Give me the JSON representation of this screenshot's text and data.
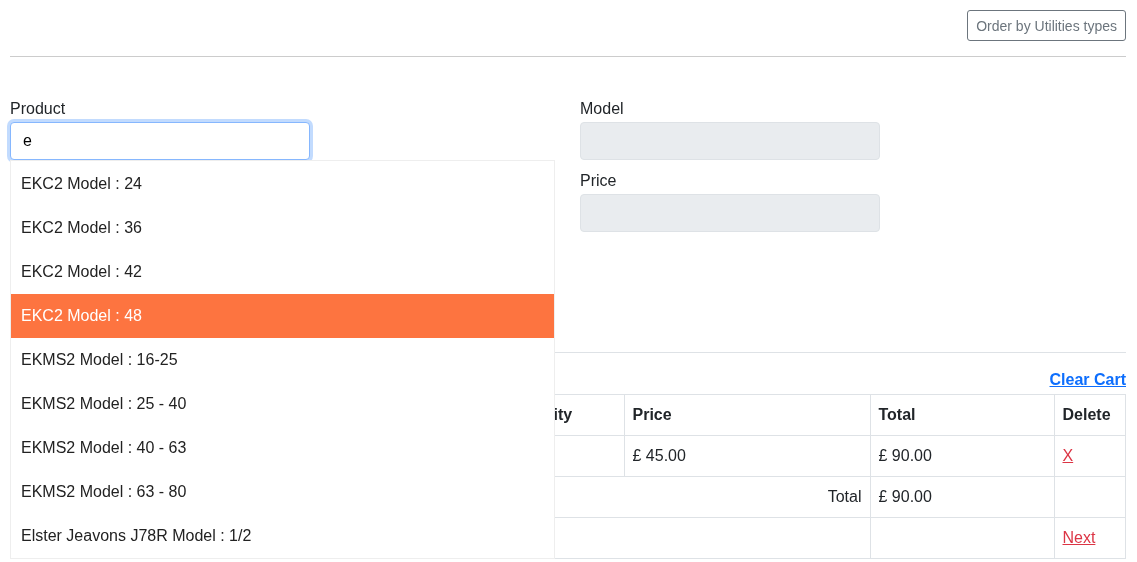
{
  "order_button": "Order by Utilities types",
  "product": {
    "label": "Product",
    "value": "e",
    "focused": true
  },
  "model": {
    "label": "Model",
    "disabled": true
  },
  "price": {
    "label": "Price",
    "disabled": true
  },
  "suggestions": [
    {
      "text": "EKC2 Model : 24",
      "selected": false
    },
    {
      "text": "EKC2 Model : 36",
      "selected": false
    },
    {
      "text": "EKC2 Model : 42",
      "selected": false
    },
    {
      "text": "EKC2 Model : 48",
      "selected": true
    },
    {
      "text": "EKMS2 Model : 16-25",
      "selected": false
    },
    {
      "text": "EKMS2 Model : 25 - 40",
      "selected": false
    },
    {
      "text": "EKMS2 Model : 40 - 63",
      "selected": false
    },
    {
      "text": "EKMS2 Model : 63 - 80",
      "selected": false
    },
    {
      "text": "Elster Jeavons J78R Model : 1/2",
      "selected": false
    }
  ],
  "clear_cart": "Clear Cart",
  "cart": {
    "headers": [
      "ity",
      "Price",
      "Total",
      "Delete"
    ],
    "rows": [
      {
        "kind": "item",
        "price": "£ 45.00",
        "total": "£ 90.00",
        "delete": "X"
      },
      {
        "kind": "total",
        "label": "Total",
        "total": "£ 90.00"
      },
      {
        "kind": "nav",
        "link": "Next"
      }
    ]
  }
}
